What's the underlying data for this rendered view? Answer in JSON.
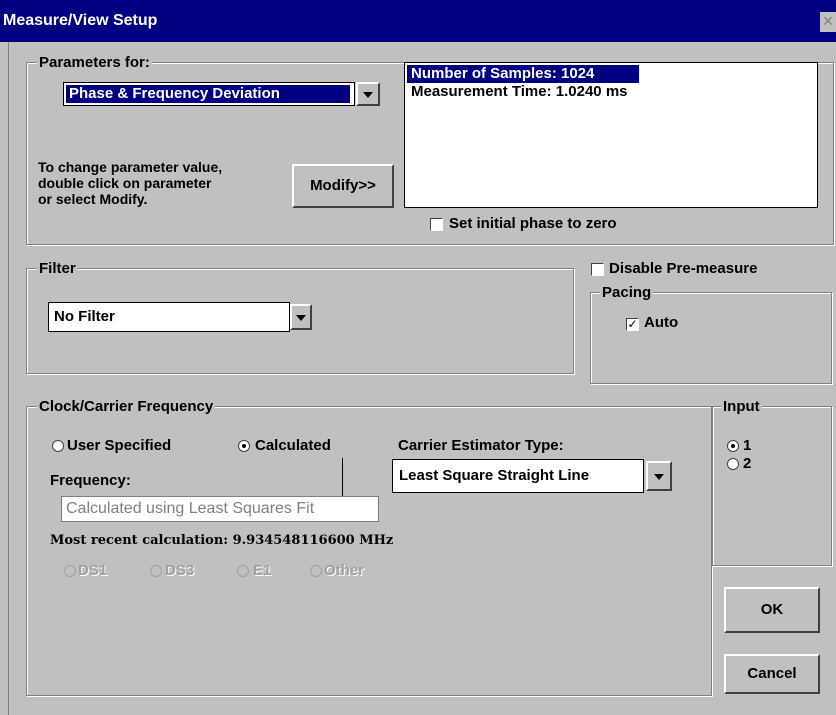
{
  "window": {
    "title": "Measure/View Setup",
    "close_glyph": "×"
  },
  "parameters": {
    "group_label": "Parameters for:",
    "selected_param": "Phase & Frequency Deviation",
    "list": [
      "Number of Samples:  1024",
      "Measurement Time: 1.0240 ms"
    ],
    "help_text": [
      "To change parameter value,",
      "double click on parameter",
      "or select Modify."
    ],
    "modify_label": "Modify>>",
    "initial_phase_label": "Set initial phase to zero",
    "initial_phase_checked": false
  },
  "filter": {
    "group_label": "Filter",
    "selected": "No Filter"
  },
  "pre_measure": {
    "label": "Disable Pre-measure",
    "checked": false
  },
  "pacing": {
    "group_label": "Pacing",
    "auto_label": "Auto",
    "auto_checked": true
  },
  "clock": {
    "group_label": "Clock/Carrier Frequency",
    "user_specified_label": "User Specified",
    "calculated_label": "Calculated",
    "selected_mode": "Calculated",
    "frequency_label": "Frequency:",
    "frequency_value": "Calculated using Least Squares Fit",
    "estimator_label": "Carrier Estimator Type:",
    "estimator_selected": "Least Square Straight Line",
    "recent_calc": "Most recent calculation: 9.934548116600 MHz",
    "standards": [
      "DS1",
      "DS3",
      "E1",
      "Other"
    ]
  },
  "input": {
    "group_label": "Input",
    "options": [
      "1",
      "2"
    ],
    "selected": "1"
  },
  "buttons": {
    "ok": "OK",
    "cancel": "Cancel"
  },
  "icons": {
    "close": "close-icon",
    "dropdown": "chevron-down-icon",
    "check": "check-icon"
  },
  "colors": {
    "titlebar": "#000080",
    "selection": "#000080",
    "face": "#c0c0c0"
  }
}
